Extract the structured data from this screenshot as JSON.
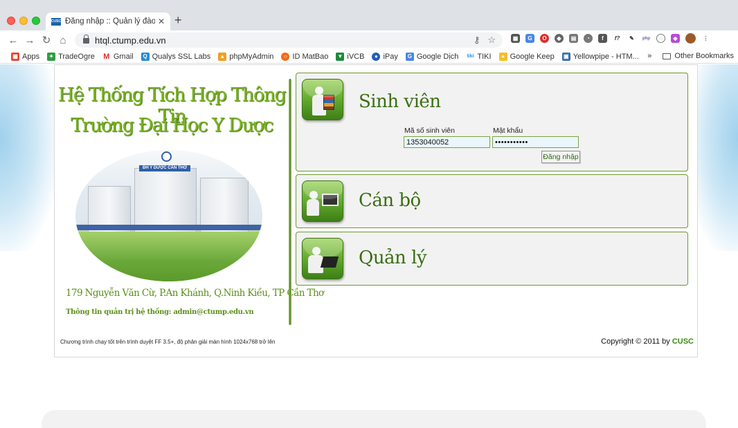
{
  "browser": {
    "tab_title": "Đăng nhập :: Quản lý đào tạo -",
    "tab_favicon_text": "CUSC",
    "url": "htql.ctump.edu.vn",
    "bookmarks": [
      {
        "label": "Apps",
        "icon": "apps-grid-icon",
        "color": "#e94335"
      },
      {
        "label": "TradeOgre",
        "icon": "tradeogre-icon",
        "color": "#2e9c3f"
      },
      {
        "label": "Gmail",
        "icon": "gmail-icon",
        "color": "#d93025"
      },
      {
        "label": "Qualys SSL Labs",
        "icon": "qualys-icon",
        "color": "#2a8ad2"
      },
      {
        "label": "phpMyAdmin",
        "icon": "phpmyadmin-icon",
        "color": "#f0a020"
      },
      {
        "label": "ID MatBao",
        "icon": "matbao-icon",
        "color": "#f26a1b"
      },
      {
        "label": "iVCB",
        "icon": "vcb-icon",
        "color": "#1c8a3c"
      },
      {
        "label": "iPay",
        "icon": "ipay-icon",
        "color": "#1f5fb5"
      },
      {
        "label": "Google Dịch",
        "icon": "google-translate-icon",
        "color": "#4a86e8"
      },
      {
        "label": "TIKI",
        "icon": "tiki-icon",
        "color": "#1a94ff"
      },
      {
        "label": "Google Keep",
        "icon": "google-keep-icon",
        "color": "#f6bf26"
      },
      {
        "label": "Yellowpipe - HTM...",
        "icon": "yellowpipe-icon",
        "color": "#3a6fb0"
      }
    ],
    "other_bookmarks": "Other Bookmarks",
    "more_bookmarks": "»"
  },
  "page": {
    "title_line1": "Hệ Thống Tích Hợp Thông Tin",
    "title_line2": "Trường Đại Học Y Dược",
    "building_sign": "ĐH Y DƯỢC CẦN THƠ",
    "address": "179 Nguyễn Văn Cừ, P.An Khánh, Q.Ninh Kiều, TP Cần Thơ",
    "admin_info": "Thông tin quản trị hệ thống: admin@ctump.edu.vn",
    "panels": {
      "student": "Sinh viên",
      "staff": "Cán bộ",
      "manager": "Quản lý"
    },
    "login": {
      "student_id_label": "Mã số sinh viên",
      "student_id_value": "1353040052",
      "password_label": "Mật khẩu",
      "password_value": "•••••••••••",
      "submit_label": "Đăng nhập"
    },
    "footer_left": "Chương trình chạy tốt trên trình duyệt FF 3.5+, độ phân giải màn hình 1024x768 trở lên",
    "footer_right_prefix": "Copyright © 2011 by ",
    "footer_right_brand": "CUSC"
  }
}
